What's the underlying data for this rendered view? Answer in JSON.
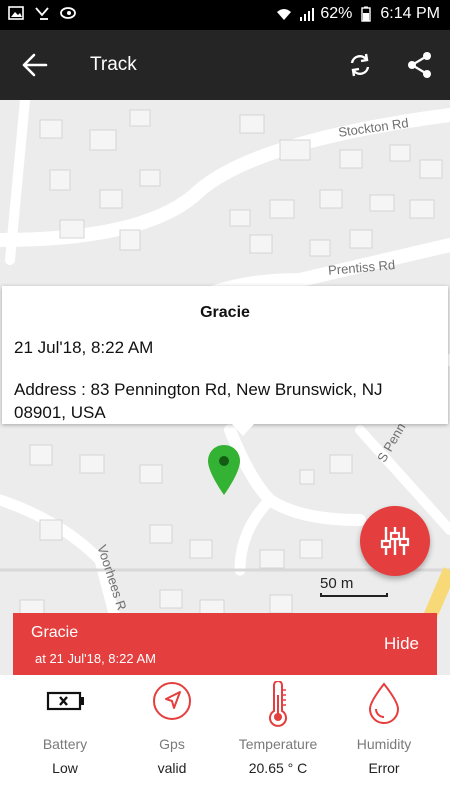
{
  "status_bar": {
    "battery_percent": "62%",
    "time": "6:14 PM",
    "left_icons": [
      "image-icon",
      "missed-call-icon",
      "app-notification-icon"
    ],
    "right_icons": [
      "wifi-icon",
      "signal-icon",
      "battery-icon"
    ]
  },
  "app_bar": {
    "title": "Track",
    "icons": [
      "back-arrow-icon",
      "refresh-icon",
      "share-icon"
    ]
  },
  "map": {
    "road_labels": {
      "stockton": "Stockton Rd",
      "prentiss": "Prentiss Rd",
      "s_penn": "S Penn",
      "voorhees": "Voorhees R"
    },
    "scale_label": "50 m",
    "marker_color": "#34b233"
  },
  "info_window": {
    "name": "Gracie",
    "date": "21 Jul'18, 8:22 AM",
    "address": "Address : 83 Pennington Rd, New Brunswick, NJ 08901, USA"
  },
  "banner": {
    "name": "Gracie",
    "time": "at 21 Jul'18, 8:22 AM",
    "hide_label": "Hide"
  },
  "sensors": [
    {
      "label": "Battery",
      "value": "Low",
      "icon": "battery-empty-icon"
    },
    {
      "label": "Gps",
      "value": "valid",
      "icon": "gps-navigation-icon"
    },
    {
      "label": "Temperature",
      "value": "20.65 ° C",
      "icon": "thermometer-icon"
    },
    {
      "label": "Humidity",
      "value": "Error",
      "icon": "water-drop-icon"
    }
  ],
  "colors": {
    "accent": "#e53e3e",
    "app_bar": "#252525",
    "map_background": "#ececec"
  }
}
